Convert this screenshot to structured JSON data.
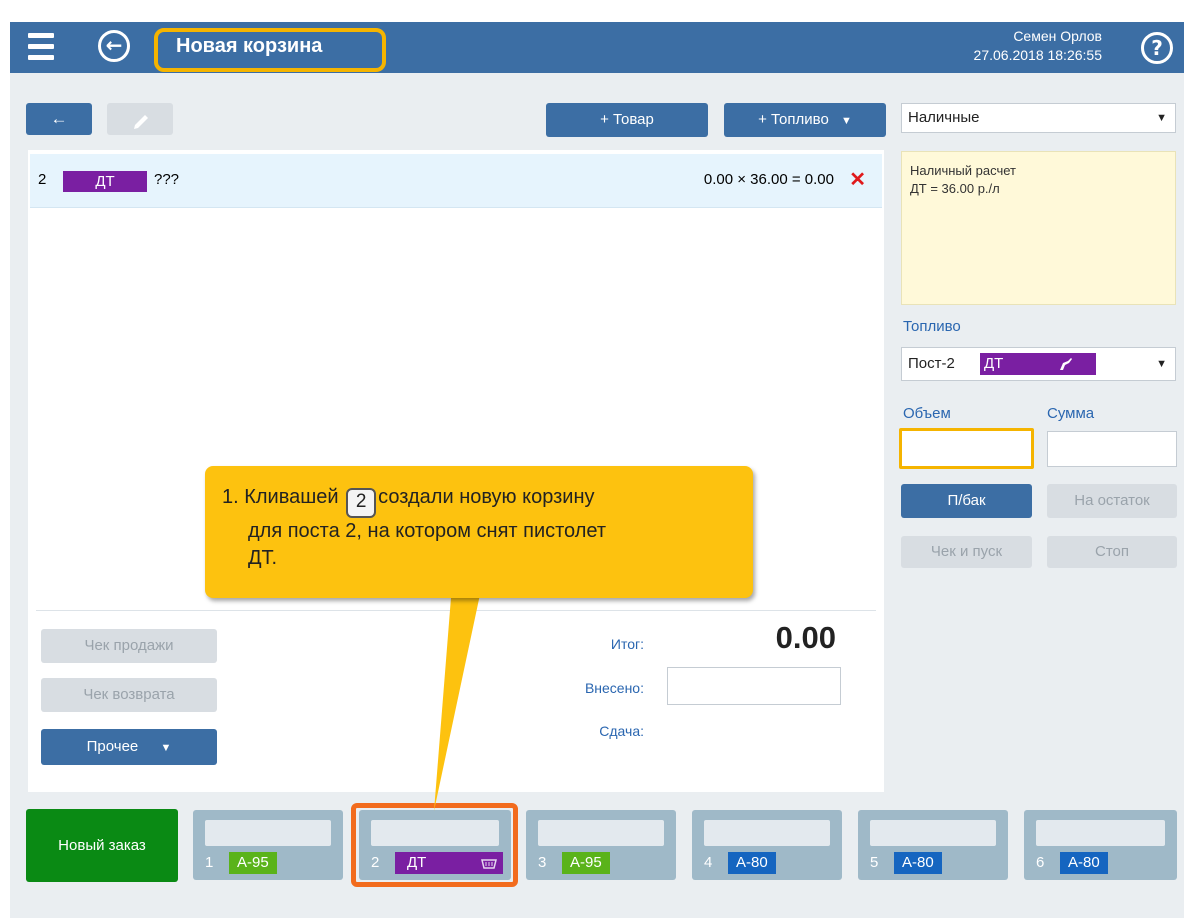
{
  "header": {
    "title": "Новая корзина",
    "user_name": "Семен Орлов",
    "datetime": "27.06.2018 18:26:55",
    "help": "?",
    "back": "←"
  },
  "toolbar": {
    "back_label": "←",
    "add_product_label": "+ Товар",
    "add_fuel_label": "+ Топливо",
    "caret": "▼"
  },
  "basket": {
    "item": {
      "post": "2",
      "fuel": "ДТ",
      "name": "???",
      "calc": "0.00 × 36.00 = 0.00",
      "remove": "✕"
    }
  },
  "payment": {
    "method": "Наличные",
    "info_line1": "Наличный расчет",
    "info_line2": "ДТ = 36.00 р./л"
  },
  "fuel_panel": {
    "label": "Топливо",
    "post": "Пост-2",
    "fuel": "ДТ",
    "volume_label": "Объем",
    "sum_label": "Сумма",
    "full_tank": "П/бак",
    "remainder": "На остаток",
    "check_start": "Чек и пуск",
    "stop": "Стоп"
  },
  "totals": {
    "total_label": "Итог:",
    "total_value": "0.00",
    "paid_label": "Внесено:",
    "change_label": "Сдача:"
  },
  "actions": {
    "sale_receipt": "Чек продажи",
    "return_receipt": "Чек возврата",
    "other": "Прочее"
  },
  "callout": {
    "part1": "1. Кливашей",
    "key": "2",
    "part2": "создали новую корзину",
    "line2": "для поста 2, на котором снят пистолет",
    "line3": "ДТ."
  },
  "bottom": {
    "new_order": "Новый заказ",
    "posts": [
      {
        "num": "1",
        "fuel": "А-95"
      },
      {
        "num": "2",
        "fuel": "ДТ"
      },
      {
        "num": "3",
        "fuel": "А-95"
      },
      {
        "num": "4",
        "fuel": "А-80"
      },
      {
        "num": "5",
        "fuel": "А-80"
      },
      {
        "num": "6",
        "fuel": "А-80"
      }
    ]
  },
  "colors": {
    "header": "#3c6ea4",
    "dt": "#7a1fa2",
    "a95": "#5ab31a",
    "a80": "#1565c0",
    "highlight_yellow": "#f5b400",
    "highlight_orange": "#f26b1d",
    "new_order": "#0a8a14"
  }
}
